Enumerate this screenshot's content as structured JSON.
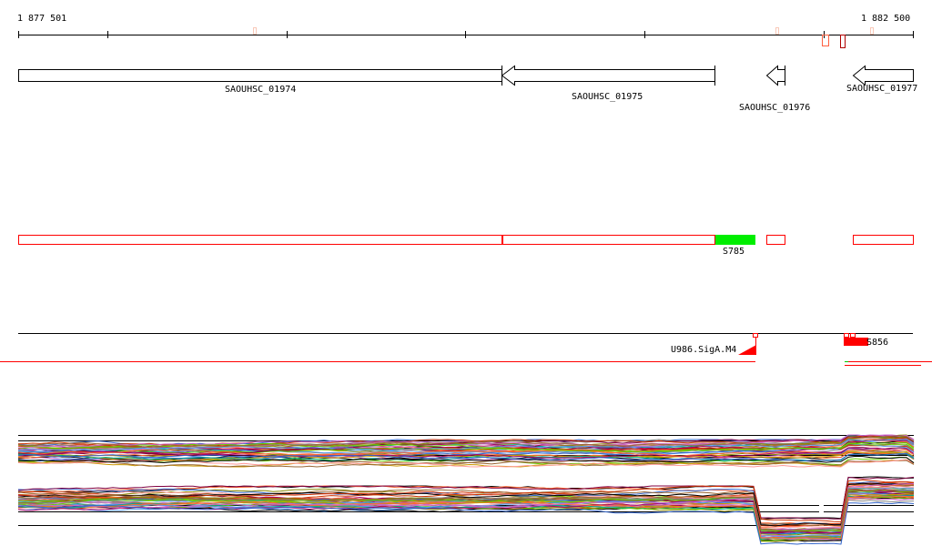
{
  "ruler": {
    "start_label": "1 877 501",
    "end_label": "1 882 500"
  },
  "genes": [
    {
      "name": "SAOUHSC_01974",
      "strand": "-"
    },
    {
      "name": "SAOUHSC_01975",
      "strand": "-"
    },
    {
      "name": "SAOUHSC_01976",
      "strand": "-"
    },
    {
      "name": "SAOUHSC_01977",
      "strand": "-"
    }
  ],
  "segments": {
    "highlight_label": "S785",
    "highlight_color": "#00ee00",
    "outline_color": "#ff0000"
  },
  "features": {
    "promoter_label": "U986.SigA.M4",
    "segment_label": "S856",
    "color": "#ff0000"
  },
  "colors": {
    "axis": "#000000",
    "gene_outline": "#000000"
  }
}
